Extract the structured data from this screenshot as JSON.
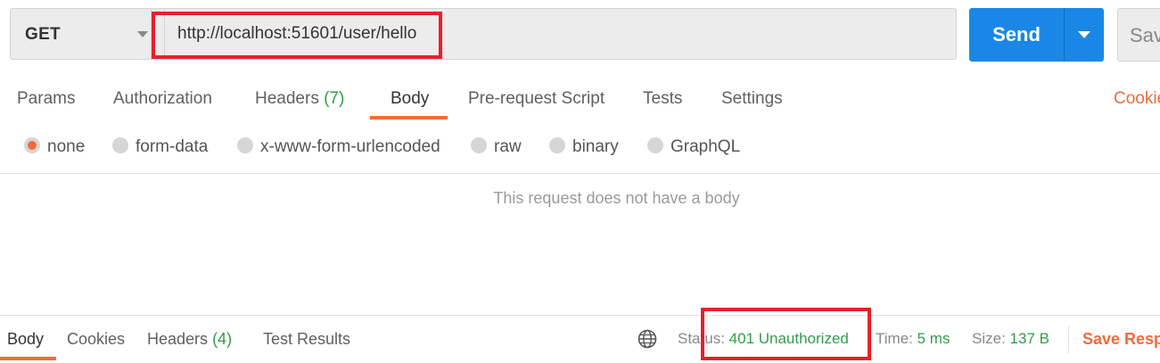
{
  "request": {
    "method": "GET",
    "url": "http://localhost:51601/user/hello",
    "send_label": "Send",
    "save_label": "Sav"
  },
  "tabs": [
    {
      "label": "Params"
    },
    {
      "label": "Authorization"
    },
    {
      "label": "Headers",
      "count": "(7)"
    },
    {
      "label": "Body"
    },
    {
      "label": "Pre-request Script"
    },
    {
      "label": "Tests"
    },
    {
      "label": "Settings"
    }
  ],
  "active_tab": "Body",
  "cookies_label": "Cookie",
  "body_types": [
    "none",
    "form-data",
    "x-www-form-urlencoded",
    "raw",
    "binary",
    "GraphQL"
  ],
  "selected_body_type": "none",
  "empty_body_message": "This request does not have a body",
  "response": {
    "tabs": [
      {
        "label": "Body"
      },
      {
        "label": "Cookies"
      },
      {
        "label": "Headers",
        "count": "(4)"
      },
      {
        "label": "Test Results"
      }
    ],
    "status_label": "Status:",
    "status_value": "401 Unauthorized",
    "time_label": "Time:",
    "time_value": "5 ms",
    "size_label": "Size:",
    "size_value": "137 B",
    "save_response_label": "Save Resp"
  },
  "colors": {
    "accent_orange": "#f26b3a",
    "send_blue": "#1a87e6",
    "status_green": "#2e9f46",
    "highlight_red": "#e8202a"
  },
  "icons": [
    "caret-down-icon",
    "globe-icon",
    "radio-icon"
  ]
}
